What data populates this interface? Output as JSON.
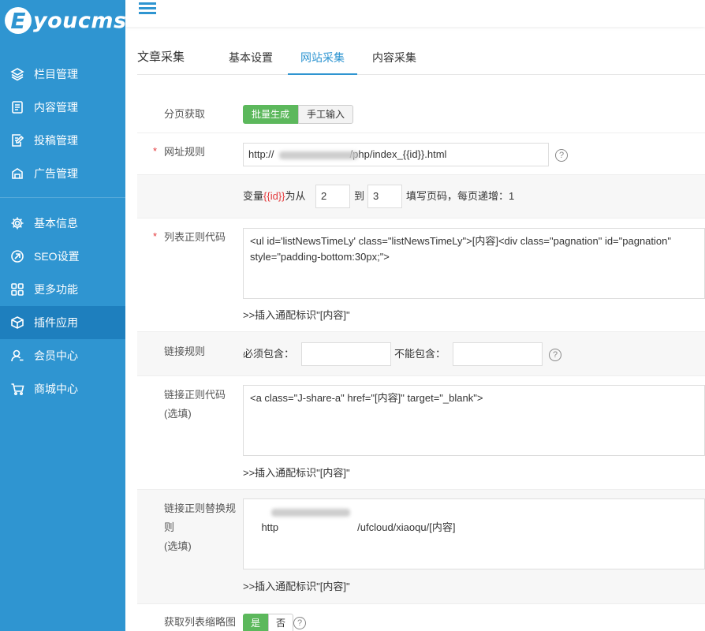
{
  "brand": {
    "logo_letter": "E",
    "logo_text": "youcms"
  },
  "sidebar": {
    "items": [
      {
        "label": "栏目管理",
        "icon": "layers-icon"
      },
      {
        "label": "内容管理",
        "icon": "document-icon"
      },
      {
        "label": "投稿管理",
        "icon": "edit-icon"
      },
      {
        "label": "广告管理",
        "icon": "ad-icon"
      },
      {
        "label": "基本信息",
        "icon": "gear-icon"
      },
      {
        "label": "SEO设置",
        "icon": "seo-icon"
      },
      {
        "label": "更多功能",
        "icon": "grid-icon"
      },
      {
        "label": "插件应用",
        "icon": "cube-icon",
        "active": true
      },
      {
        "label": "会员中心",
        "icon": "user-icon"
      },
      {
        "label": "商城中心",
        "icon": "cart-icon"
      }
    ]
  },
  "tabs": {
    "title": "文章采集",
    "items": [
      "基本设置",
      "网站采集",
      "内容采集"
    ],
    "active_index": 1
  },
  "form": {
    "pagination": {
      "label": "分页获取",
      "options": [
        "批量生成",
        "手工输入"
      ],
      "selected": "批量生成"
    },
    "url_rule": {
      "label": "网址规则",
      "value_prefix": "http://",
      "value_suffix": "/php/index_{{id}}.html",
      "help": "?"
    },
    "variable": {
      "prefix": "变量",
      "var_name": "{{id}}",
      "from_text": "为从",
      "from_value": "2",
      "to_text": "到",
      "to_value": "3",
      "suffix": "填写页码，每页递增：1"
    },
    "list_regex": {
      "label": "列表正则代码",
      "value": "<ul id='listNewsTimeLy' class=\"listNewsTimeLy\">[内容]<div class=\"pagnation\" id=\"pagnation\" style=\"padding-bottom:30px;\">",
      "insert_link": ">>插入通配标识\"[内容]\""
    },
    "link_rule": {
      "label": "链接规则",
      "must_contain_label": "必须包含：",
      "must_contain_value": "",
      "not_contain_label": "不能包含：",
      "not_contain_value": "",
      "help": "?"
    },
    "link_regex": {
      "label_line1": "链接正则代码",
      "label_line2": "(选填)",
      "value": "<a class=\"J-share-a\" href=\"[内容]\" target=\"_blank\">",
      "insert_link": ">>插入通配标识\"[内容]\""
    },
    "link_replace": {
      "label_line1": "链接正则替换规",
      "label_line2": "则",
      "label_line3": "(选填)",
      "value_prefix": "http",
      "value_suffix": "/ufcloud/xiaoqu/[内容]",
      "insert_link": ">>插入通配标识\"[内容]\""
    },
    "thumbnail": {
      "label": "获取列表缩略图",
      "options": [
        "是",
        "否"
      ],
      "selected": "是",
      "help": "?"
    }
  },
  "colors": {
    "sidebar_bg": "#2f95d1",
    "sidebar_active": "#1e7fbe",
    "accent": "#2f95d1",
    "success": "#5cb85c",
    "required": "#e4393c"
  }
}
